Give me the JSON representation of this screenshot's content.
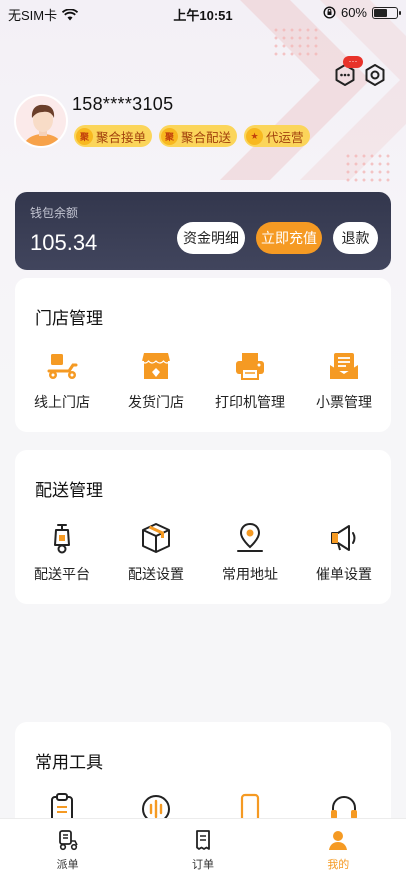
{
  "status_bar": {
    "carrier": "无SIM卡",
    "time": "上午10:51",
    "battery_text": "60%",
    "battery_level": 0.6,
    "icons": [
      "wifi-icon",
      "orientation-lock-icon",
      "battery-icon"
    ]
  },
  "header": {
    "message_badge": "···",
    "icons": [
      "message-icon",
      "settings-icon"
    ]
  },
  "profile": {
    "phone": "158****3105",
    "tags": [
      {
        "icon_text": "聚",
        "label": "聚合接单"
      },
      {
        "icon_text": "聚",
        "label": "聚合配送"
      },
      {
        "icon_text": "★",
        "label": "代运营"
      }
    ]
  },
  "wallet": {
    "label": "钱包余额",
    "amount": "105.34",
    "detail_button": "资金明细",
    "recharge_button": "立即充值",
    "refund_button": "退款"
  },
  "store_management": {
    "title": "门店管理",
    "items": [
      {
        "icon": "scooter-store-icon",
        "label": "线上门店"
      },
      {
        "icon": "shop-icon",
        "label": "发货门店"
      },
      {
        "icon": "printer-icon",
        "label": "打印机管理"
      },
      {
        "icon": "receipt-icon",
        "label": "小票管理"
      }
    ]
  },
  "delivery_management": {
    "title": "配送管理",
    "items": [
      {
        "icon": "scooter-icon",
        "label": "配送平台"
      },
      {
        "icon": "box-icon",
        "label": "配送设置"
      },
      {
        "icon": "location-pin-icon",
        "label": "常用地址"
      },
      {
        "icon": "megaphone-icon",
        "label": "催单设置"
      }
    ]
  },
  "tools": {
    "title": "常用工具",
    "items": [
      {
        "icon": "clipboard-icon"
      },
      {
        "icon": "voice-icon"
      },
      {
        "icon": "phone-icon"
      },
      {
        "icon": "headset-icon"
      }
    ]
  },
  "tabbar": {
    "tabs": [
      {
        "icon": "dispatch-icon",
        "label": "派单"
      },
      {
        "icon": "order-icon",
        "label": "订单"
      },
      {
        "icon": "profile-icon",
        "label": "我的",
        "active": true
      }
    ]
  },
  "colors": {
    "accent": "#f59a23",
    "tag_bg": "#fbd55a",
    "wallet_bg": "#363a50",
    "badge": "#e8322a"
  }
}
